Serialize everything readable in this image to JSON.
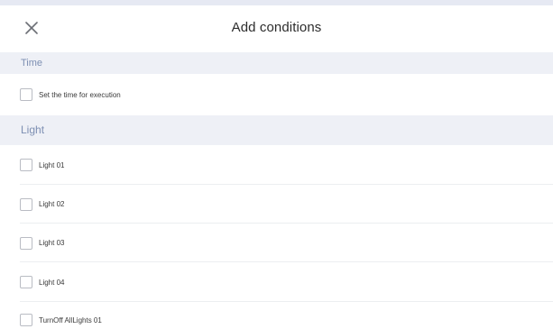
{
  "header": {
    "title": "Add conditions",
    "close_icon": "close-icon"
  },
  "sections": [
    {
      "title": "Time",
      "items": [
        {
          "label": "Set the time for execution",
          "checked": false
        }
      ]
    },
    {
      "title": "Light",
      "items": [
        {
          "label": "Light 01",
          "checked": false
        },
        {
          "label": "Light 02",
          "checked": false
        },
        {
          "label": "Light 03",
          "checked": false
        },
        {
          "label": "Light 04",
          "checked": false
        },
        {
          "label": "TurnOff AllLights 01",
          "checked": false
        }
      ]
    }
  ],
  "colors": {
    "section_bg": "#eef0f6",
    "section_text": "#7d8fb3",
    "checkbox_border": "#b9bcc3"
  }
}
